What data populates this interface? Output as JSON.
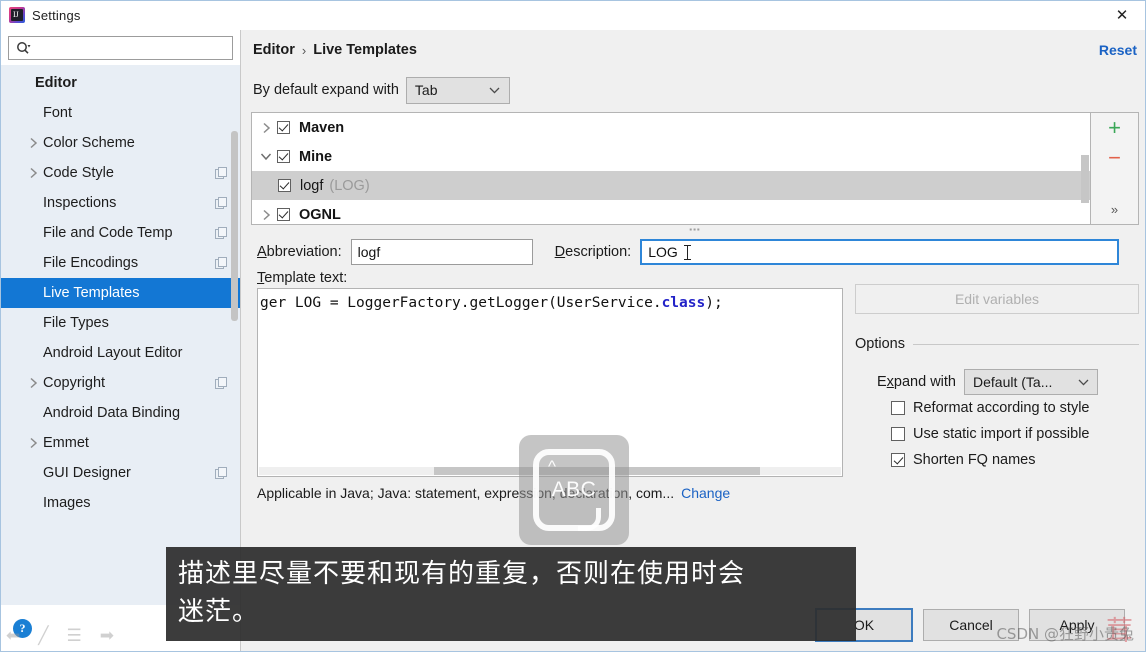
{
  "window": {
    "title": "Settings",
    "app_icon": "intellij-idea-icon",
    "close_label": "✕"
  },
  "search": {
    "value": "",
    "placeholder": "",
    "icon": "search-icon"
  },
  "sidebar": {
    "items": [
      {
        "label": "Editor",
        "indent": 0,
        "bold": true,
        "twisty": "none",
        "badge": false,
        "selected": false
      },
      {
        "label": "Font",
        "indent": 1,
        "bold": false,
        "twisty": "none",
        "badge": false,
        "selected": false
      },
      {
        "label": "Color Scheme",
        "indent": 1,
        "bold": false,
        "twisty": "right",
        "badge": false,
        "selected": false
      },
      {
        "label": "Code Style",
        "indent": 1,
        "bold": false,
        "twisty": "right",
        "badge": true,
        "selected": false
      },
      {
        "label": "Inspections",
        "indent": 1,
        "bold": false,
        "twisty": "none",
        "badge": true,
        "selected": false
      },
      {
        "label": "File and Code Temp",
        "indent": 1,
        "bold": false,
        "twisty": "none",
        "badge": true,
        "selected": false
      },
      {
        "label": "File Encodings",
        "indent": 1,
        "bold": false,
        "twisty": "none",
        "badge": true,
        "selected": false
      },
      {
        "label": "Live Templates",
        "indent": 1,
        "bold": false,
        "twisty": "none",
        "badge": false,
        "selected": true
      },
      {
        "label": "File Types",
        "indent": 1,
        "bold": false,
        "twisty": "none",
        "badge": false,
        "selected": false
      },
      {
        "label": "Android Layout Editor",
        "indent": 1,
        "bold": false,
        "twisty": "none",
        "badge": false,
        "selected": false
      },
      {
        "label": "Copyright",
        "indent": 1,
        "bold": false,
        "twisty": "right",
        "badge": true,
        "selected": false
      },
      {
        "label": "Android Data Binding",
        "indent": 1,
        "bold": false,
        "twisty": "none",
        "badge": false,
        "selected": false
      },
      {
        "label": "Emmet",
        "indent": 1,
        "bold": false,
        "twisty": "right",
        "badge": false,
        "selected": false
      },
      {
        "label": "GUI Designer",
        "indent": 1,
        "bold": false,
        "twisty": "none",
        "badge": true,
        "selected": false
      },
      {
        "label": "Images",
        "indent": 1,
        "bold": false,
        "twisty": "none",
        "badge": false,
        "selected": false
      }
    ],
    "help_label": "?"
  },
  "header": {
    "breadcrumb_parent": "Editor",
    "breadcrumb_separator": "›",
    "breadcrumb_current": "Live Templates",
    "reset_label": "Reset"
  },
  "expand_default": {
    "label": "By default expand with",
    "value": "Tab"
  },
  "templates": {
    "rows": [
      {
        "name": "Maven",
        "description": "",
        "checked": true,
        "twisty": "right",
        "child": false,
        "selected": false
      },
      {
        "name": "Mine",
        "description": "",
        "checked": true,
        "twisty": "down",
        "child": false,
        "selected": false
      },
      {
        "name": "logf",
        "description": "(LOG)",
        "checked": true,
        "twisty": "none",
        "child": true,
        "selected": true
      },
      {
        "name": "OGNL",
        "description": "",
        "checked": true,
        "twisty": "right",
        "child": false,
        "selected": false
      }
    ],
    "add_label": "+",
    "remove_label": "−",
    "more_label": "»"
  },
  "fields": {
    "abbreviation_label_pre": "A",
    "abbreviation_label_mnemonic": "A",
    "abbreviation_label": "Abbreviation:",
    "abbreviation_value": "logf",
    "description_label": "Description:",
    "description_value": "LOG"
  },
  "template_text": {
    "label": "Template text:",
    "code_before": "ger LOG = LoggerFactory.getLogger(UserService.",
    "code_keyword": "class",
    "code_after": ");"
  },
  "applicable": {
    "text": "Applicable in Java; Java: statement, expression, declaration, com...",
    "change_label": "Change"
  },
  "options": {
    "edit_variables_label": "Edit variables",
    "section_title": "Options",
    "expand_with_label": "Expand with",
    "expand_with_value": "Default (Ta...",
    "checkboxes": [
      {
        "label": "Reformat according to style",
        "checked": false
      },
      {
        "label": "Use static import if possible",
        "checked": false
      },
      {
        "label": "Shorten FQ names",
        "checked": true
      }
    ]
  },
  "dialog_buttons": [
    {
      "label": "OK",
      "default": true
    },
    {
      "label": "Cancel",
      "default": false
    },
    {
      "label": "Apply",
      "default": false
    }
  ],
  "overlays": {
    "ime_indicator": "ABC",
    "subtitle_line1": "描述里尽量不要和现有的重复，否则在使用时会",
    "subtitle_line2": "迷茫。",
    "watermark": "CSDN @狂野小贵兔"
  },
  "colors": {
    "accent": "#1377d4",
    "link": "#1a62c4",
    "add": "#3aa757",
    "remove": "#e2614a",
    "focus_border": "#2e86d8"
  }
}
